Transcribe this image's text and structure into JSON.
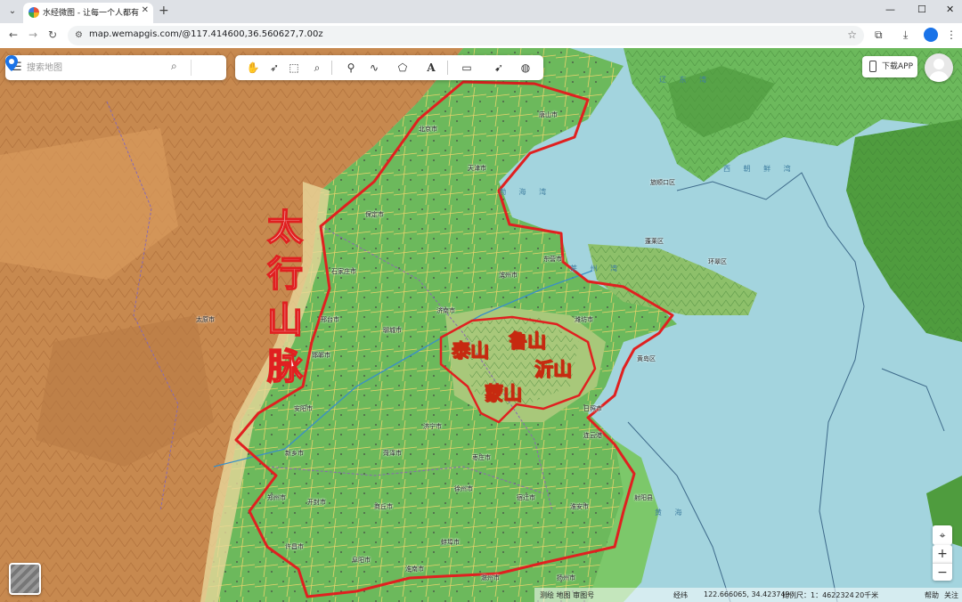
{
  "browser": {
    "tab_title": "水经微图 - 让每一个人都有自己",
    "url": "map.wemapgis.com/@117.414600,36.560627,7.00z",
    "new_tab": "+",
    "tab_close": "✕",
    "win_min": "—",
    "win_max": "☐",
    "win_close": "✕"
  },
  "search": {
    "placeholder": "搜索地图"
  },
  "toolbar": {
    "tools": [
      "pan-hand-icon",
      "select-arrow-icon",
      "select-region-icon",
      "zoom-search-icon",
      "marker-icon",
      "polyline-icon",
      "polygon-icon",
      "text-icon",
      "measure-ruler-icon",
      "clear-pointer-icon",
      "globe-icon"
    ]
  },
  "app_button": {
    "label": "下载APP"
  },
  "annotations": {
    "taihang": "太行山脉",
    "taishan": "泰山",
    "lushan": "鲁山",
    "yishan": "沂山",
    "mengshan": "蒙山"
  },
  "seas": {
    "bohai_bay": "渤 海 湾",
    "laizhou_bay": "莱 州 湾",
    "north_korea_bay": "西 朝 鲜 湾",
    "bay_top": "辽 东 湾",
    "yellow_sea": "黄 海"
  },
  "places": {
    "shijiazhuang": "石家庄市",
    "jinan": "济南市",
    "laiwu": "济宁市",
    "zaozhuang": "枣庄市",
    "xuzhou": "徐州市",
    "dalian": "旅顺口区",
    "lianyungang": "连云港",
    "rizhao": "日照市",
    "yantai": "蓬莱区",
    "weihai": "环翠区",
    "qingdao": "黄岛区",
    "tangshan": "唐山市",
    "zhengzhou": "郑州市",
    "kaifeng": "开封市",
    "liaocheng": "聊城市",
    "heze": "菏泽市",
    "suqian": "宿迁市",
    "huaian": "淮安市",
    "sheyang": "射阳县",
    "bengbu": "蚌埠市",
    "binzhou": "滨州市",
    "dongying": "东营市",
    "weifang": "潍坊市",
    "taiyuan": "太原市",
    "tianjin": "天津市",
    "beijing": "北京市",
    "baoding": "保定市",
    "xingtai": "邢台市",
    "handan": "邯郸市",
    "anyang": "安阳市",
    "xinxiang": "新乡市",
    "xuchang": "许昌市",
    "shangqiu": "商丘市",
    "fuyang": "阜阳市",
    "huainan": "淮南市",
    "chuzhou": "滁州市",
    "yangzhou": "扬州市"
  },
  "status": {
    "coords": "122.666065, 34.423749",
    "scale_label": "比例尺：1：4622324",
    "scale_bar": "20千米",
    "feedback": "帮助",
    "about": "关注",
    "left_text": "测绘 地图 审图号",
    "right_mid": "经纬"
  },
  "colors": {
    "sea": "#9fd2dc",
    "plain": "#6bb85a",
    "mountain": "#c98a4e",
    "outline": "#e02020"
  }
}
